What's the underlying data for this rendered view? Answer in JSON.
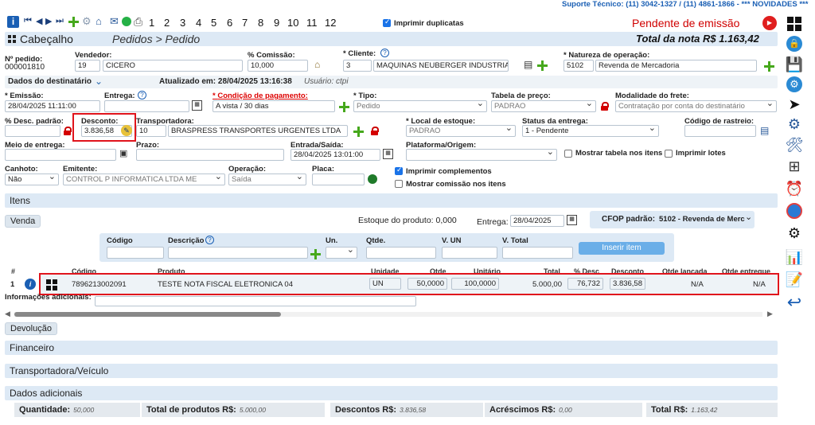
{
  "support_text": "Suporte Técnico: (11) 3042-1327 / (11) 4861-1866 - *** NOVIDADES ***",
  "toolbar": {
    "pages": [
      "1",
      "2",
      "3",
      "4",
      "5",
      "6",
      "7",
      "8",
      "9",
      "10",
      "11",
      "12"
    ],
    "print_duplicates_label": "Imprimir duplicatas"
  },
  "status": "Pendente de emissão",
  "total_nota": "Total da nota R$ 1.163,42",
  "header": {
    "title": "Cabeçalho",
    "breadcrumb": "Pedidos > Pedido"
  },
  "order": {
    "pedido_label": "Nº pedido:",
    "pedido": "000001810",
    "vendedor_label": "Vendedor:",
    "vendedor_code": "19",
    "vendedor_name": "CICERO",
    "comissao_label": "% Comissão:",
    "comissao": "10,000",
    "cliente_label": "Cliente:",
    "cliente_code": "3",
    "cliente_name": "MAQUINAS NEUBERGER INDUSTRIA E",
    "natureza_label": "Natureza de operação:",
    "natureza_code": "5102",
    "natureza_name": "Revenda de Mercadoria"
  },
  "dest": {
    "label": "Dados do destinatário",
    "updated": "Atualizado em: 28/04/2025 13:16:38",
    "user": "Usuário: ctpi"
  },
  "row1": {
    "emissao_label": "Emissão:",
    "emissao": "28/04/2025 11:11:00",
    "entrega_label": "Entrega:",
    "entrega": "",
    "cond_label": "Condição de pagamento:",
    "cond": "A vista / 30 dias",
    "tipo_label": "Tipo:",
    "tipo": "Pedido",
    "tabela_label": "Tabela de preço:",
    "tabela": "PADRAO",
    "frete_label": "Modalidade do frete:",
    "frete": "Contratação por conta do destinatário"
  },
  "row2": {
    "desc_padrao_label": "% Desc. padrão:",
    "desc_padrao": "",
    "desconto_label": "Desconto:",
    "desconto": "3.836,58",
    "transp_label": "Transportadora:",
    "transp_code": "10",
    "transp_name": "BRASPRESS TRANSPORTES URGENTES LTDA",
    "local_label": "Local de estoque:",
    "local": "PADRAO",
    "status_entrega_label": "Status da entrega:",
    "status_entrega": "1 - Pendente",
    "rastreio_label": "Código de rastreio:",
    "rastreio": ""
  },
  "row3": {
    "meio_label": "Meio de entrega:",
    "meio": "",
    "prazo_label": "Prazo:",
    "prazo": "",
    "entrada_label": "Entrada/Saída:",
    "entrada": "28/04/2025 13:01:00",
    "plataforma_label": "Plataforma/Origem:",
    "plataforma": "",
    "mostrar_tabela": "Mostrar tabela nos itens",
    "imprimir_lotes": "Imprimir lotes"
  },
  "row4": {
    "canhoto_label": "Canhoto:",
    "canhoto": "Não",
    "emitente_label": "Emitente:",
    "emitente": "CONTROL P INFORMATICA LTDA ME",
    "operacao_label": "Operação:",
    "operacao": "Saída",
    "placa_label": "Placa:",
    "placa": "",
    "imprimir_compl": "Imprimir complementos",
    "mostrar_comissao": "Mostrar comissão nos itens"
  },
  "itens": {
    "title": "Itens",
    "venda": "Venda",
    "estoque": "Estoque do produto: 0,000",
    "entrega_label": "Entrega:",
    "entrega": "28/04/2025",
    "cfop_label": "CFOP padrão:",
    "cfop": "5102 - Revenda de Merc",
    "add": {
      "codigo": "Código",
      "descricao": "Descrição",
      "un": "Un.",
      "qtde": "Qtde.",
      "vun": "V. UN",
      "vtotal": "V. Total",
      "inserir": "Inserir item"
    },
    "headers": [
      "#",
      "Código",
      "Produto",
      "Unidade",
      "Qtde",
      "Unitário",
      "Total",
      "% Desc",
      "Desconto",
      "Qtde lançada",
      "Qtde entregue"
    ],
    "row": {
      "n": "1",
      "codigo": "7896213002091",
      "produto": "TESTE NOTA FISCAL ELETRONICA 04",
      "unidade": "UN",
      "qtde": "50,0000",
      "unitario": "100,0000",
      "total": "5.000,00",
      "pdesc": "76,732",
      "desconto": "3.836,58",
      "lancada": "N/A",
      "entregue": "N/A"
    },
    "info_label": "Informações adicionais:"
  },
  "sections": {
    "devolucao": "Devolução",
    "financeiro": "Financeiro",
    "transportadora": "Transportadora/Veículo",
    "adicionais": "Dados adicionais"
  },
  "footer": {
    "quantidade_label": "Quantidade:",
    "quantidade": "50,000",
    "produtos_label": "Total de produtos R$:",
    "produtos": "5.000,00",
    "descontos_label": "Descontos R$:",
    "descontos": "3.836,58",
    "acrescimos_label": "Acréscimos R$:",
    "acrescimos": "0,00",
    "total_label": "Total R$:",
    "total": "1.163,42"
  }
}
